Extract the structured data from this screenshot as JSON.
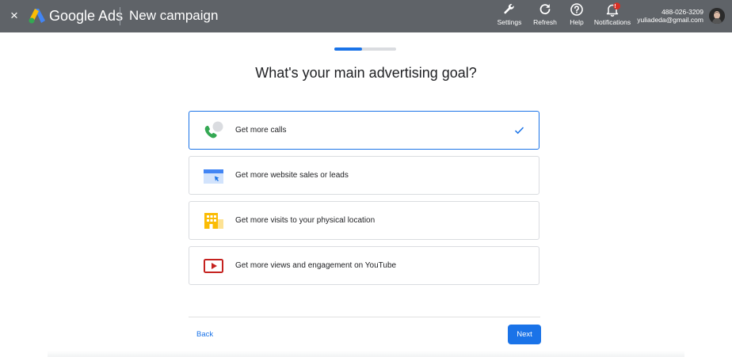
{
  "header": {
    "close_icon": "×",
    "brand": "Google Ads",
    "title": "New campaign",
    "tools": [
      {
        "label": "Settings",
        "icon": "wrench-icon"
      },
      {
        "label": "Refresh",
        "icon": "refresh-icon"
      },
      {
        "label": "Help",
        "icon": "help-icon"
      },
      {
        "label": "Notifications",
        "icon": "bell-icon",
        "badge": "!"
      }
    ],
    "account": {
      "phone": "488-026-3209",
      "email": "yuliadeda@gmail.com"
    }
  },
  "progress": {
    "value": 0.45
  },
  "heading": "What's your main advertising goal?",
  "goals": [
    {
      "label": "Get more calls",
      "icon": "phone-icon",
      "selected": true
    },
    {
      "label": "Get more website sales or leads",
      "icon": "website-icon",
      "selected": false
    },
    {
      "label": "Get more visits to your physical location",
      "icon": "store-icon",
      "selected": false
    },
    {
      "label": "Get more views and engagement on YouTube",
      "icon": "youtube-icon",
      "selected": false
    }
  ],
  "footer": {
    "back_label": "Back",
    "next_label": "Next"
  },
  "colors": {
    "topbar": "#5f6368",
    "accent": "#1a73e8",
    "phone_green": "#34a853",
    "store_yellow": "#fbbc04",
    "youtube_red": "#c5221f"
  }
}
